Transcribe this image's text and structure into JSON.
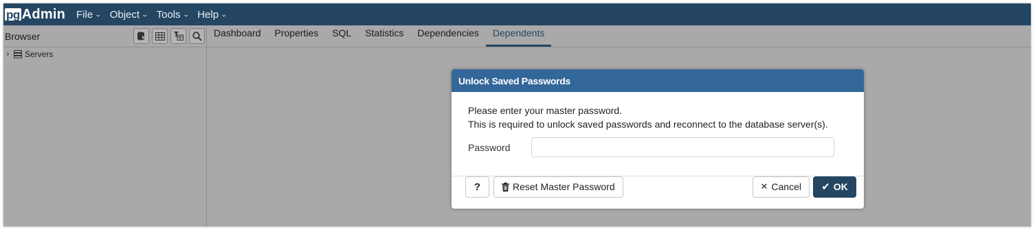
{
  "app": {
    "logo_pg": "pg",
    "logo_admin": "Admin",
    "menus": [
      {
        "label": "File"
      },
      {
        "label": "Object"
      },
      {
        "label": "Tools"
      },
      {
        "label": "Help"
      }
    ]
  },
  "browser": {
    "title": "Browser",
    "tree": [
      {
        "label": "Servers"
      }
    ]
  },
  "tabs": [
    {
      "label": "Dashboard"
    },
    {
      "label": "Properties"
    },
    {
      "label": "SQL"
    },
    {
      "label": "Statistics"
    },
    {
      "label": "Dependencies"
    },
    {
      "label": "Dependents",
      "active": true
    }
  ],
  "dialog": {
    "title": "Unlock Saved Passwords",
    "message_line1": "Please enter your master password.",
    "message_line2": "This is required to unlock saved passwords and reconnect to the database server(s).",
    "password_label": "Password",
    "password_value": "",
    "help_label": "?",
    "reset_label": "Reset Master Password",
    "cancel_label": "Cancel",
    "ok_label": "OK"
  },
  "colors": {
    "navbar": "#244662",
    "dialog_header": "#336699",
    "ok_button": "#244662",
    "overlay": "#a9a9a9"
  }
}
